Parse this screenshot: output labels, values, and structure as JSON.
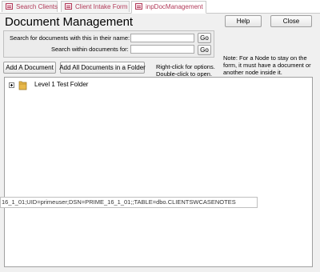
{
  "tabs": [
    {
      "label": "Search Clients",
      "active": false
    },
    {
      "label": "Client Intake Form",
      "active": false
    },
    {
      "label": "inpDocManagement",
      "active": true
    }
  ],
  "form": {
    "title": "Document Management",
    "help_label": "Help",
    "close_label": "Close",
    "search_name_label": "Search for documents with this in their name:",
    "search_within_label": "Search within documents for:",
    "go_label": "Go",
    "search_name_value": "",
    "search_within_value": "",
    "add_document_label": "Add A Document",
    "add_folder_docs_label": "Add All Documents in a Folder",
    "hint_line1": "Right-click for options.",
    "hint_line2": "Double-click to open.",
    "note_line1": "Note: For a Node to stay on the",
    "note_line2": "form, it must have a document or",
    "note_line3": "another node inside it."
  },
  "tree": {
    "nodes": [
      {
        "label": "Level 1 Test Folder",
        "icon": "folder-icon",
        "expanded": false
      }
    ]
  },
  "connection_string": "16_1_01;UID=primeuser;DSN=PRIME_16_1_01;;TABLE=dbo.CLIENTSWCASENOTES",
  "colors": {
    "tab_text": "#b13a59",
    "form_bg": "#f0f0f0",
    "folder": "#e8b84a"
  }
}
